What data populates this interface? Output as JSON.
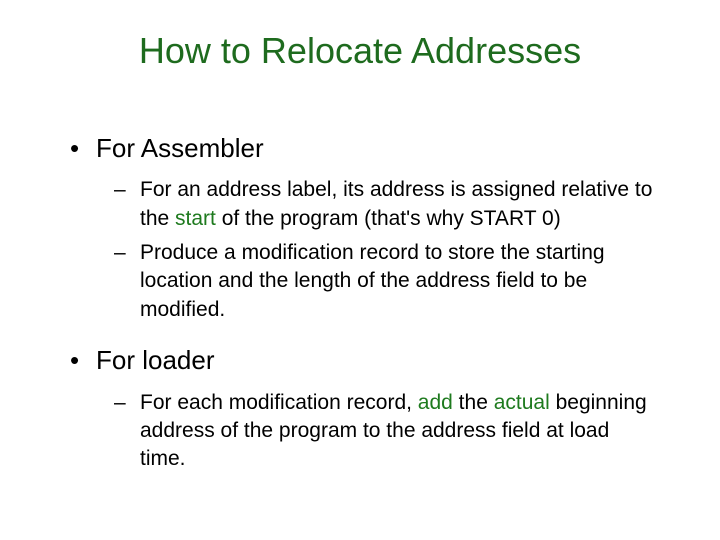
{
  "title": "How to Relocate Addresses",
  "sections": [
    {
      "heading": "For Assembler",
      "items": [
        {
          "pre": "For an address label, its address is assigned relative to the ",
          "hl": "start",
          "post": " of the program (that's why START 0)"
        },
        {
          "pre": "Produce a modification record to store the starting location and the length of the address field to be modified.",
          "hl": "",
          "post": ""
        }
      ]
    },
    {
      "heading": "For loader",
      "items": [
        {
          "pre": "For each modification record, ",
          "hl": "add",
          "mid": " the ",
          "hl2": "actual",
          "post": " beginning address of the program to the address field at load time."
        }
      ]
    }
  ]
}
